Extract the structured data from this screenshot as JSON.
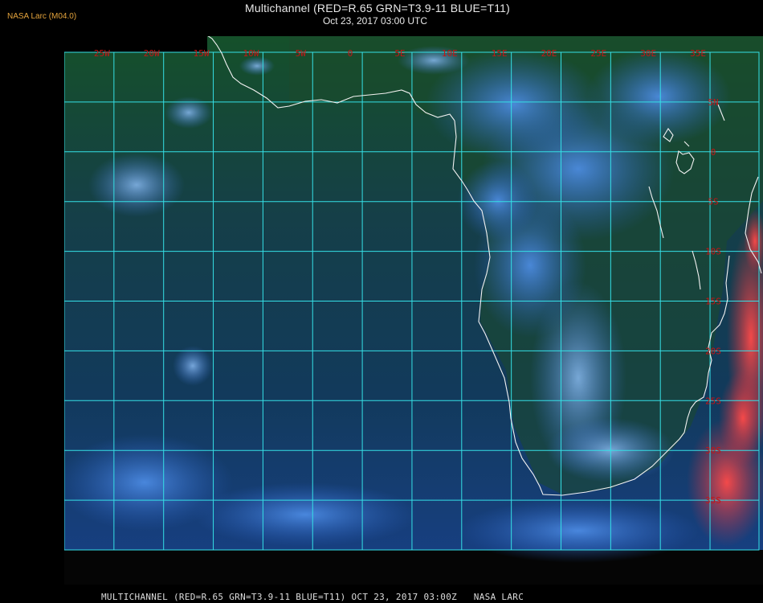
{
  "header": {
    "credit": "NASA Larc (M04.0)",
    "title": "Multichannel (RED=R.65 GRN=T3.9-11 BLUE=T11)",
    "subtitle": "Oct 23, 2017 03:00 UTC"
  },
  "footer": {
    "caption": "MULTICHANNEL (RED=R.65 GRN=T3.9-11 BLUE=T11) OCT 23, 2017 03:00Z   NASA LARC"
  },
  "map": {
    "grid_color": "#35e0e6",
    "label_color": "#c81414",
    "coast_color": "#f2f2f2",
    "lon_labels": [
      "25W",
      "20W",
      "15W",
      "10W",
      "5W",
      "0",
      "5E",
      "10E",
      "15E",
      "20E",
      "25E",
      "30E",
      "35E"
    ],
    "lat_labels": [
      "5N",
      "0",
      "5S",
      "10S",
      "15S",
      "20S",
      "25S",
      "30S",
      "35S"
    ]
  }
}
